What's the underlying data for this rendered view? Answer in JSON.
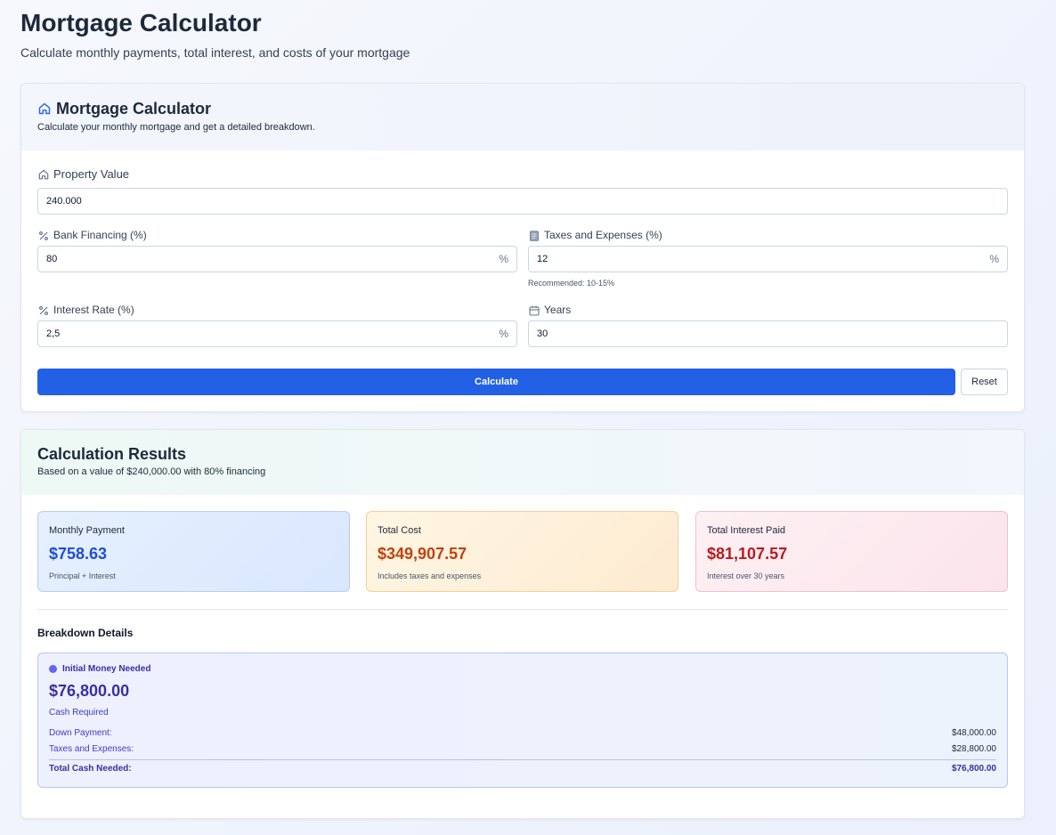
{
  "page": {
    "title": "Mortgage Calculator",
    "subtitle": "Calculate monthly payments, total interest, and costs of your mortgage"
  },
  "calculator": {
    "title": "Mortgage Calculator",
    "description": "Calculate your monthly mortgage and get a detailed breakdown.",
    "property_value": {
      "label": "Property Value",
      "value": "240.000"
    },
    "bank_financing": {
      "label": "Bank Financing (%)",
      "value": "80",
      "suffix": "%"
    },
    "taxes_expenses": {
      "label": "Taxes and Expenses (%)",
      "value": "12",
      "suffix": "%",
      "hint": "Recommended: 10-15%"
    },
    "interest_rate": {
      "label": "Interest Rate (%)",
      "value": "2,5",
      "suffix": "%"
    },
    "years": {
      "label": "Years",
      "value": "30"
    },
    "calculate_label": "Calculate",
    "reset_label": "Reset"
  },
  "results": {
    "title": "Calculation Results",
    "description": "Based on a value of $240,000.00 with 80% financing",
    "monthly": {
      "label": "Monthly Payment",
      "value": "$758.63",
      "note": "Principal + Interest"
    },
    "total_cost": {
      "label": "Total Cost",
      "value": "$349,907.57",
      "note": "Includes taxes and expenses"
    },
    "total_interest": {
      "label": "Total Interest Paid",
      "value": "$81,107.57",
      "note": "Interest over 30 years"
    },
    "breakdown_title": "Breakdown Details",
    "initial": {
      "title": "Initial Money Needed",
      "amount": "$76,800.00",
      "subtitle": "Cash Required",
      "rows": [
        {
          "label": "Down Payment:",
          "value": "$48,000.00"
        },
        {
          "label": "Taxes and Expenses:",
          "value": "$28,800.00"
        }
      ],
      "total": {
        "label": "Total Cash Needed:",
        "value": "$76,800.00"
      }
    }
  },
  "colors": {
    "primary": "#2260e6",
    "monthly": "#1d4ed8",
    "total_cost": "#c2410c",
    "interest": "#b91c1c",
    "breakdown": "#3730a3"
  }
}
